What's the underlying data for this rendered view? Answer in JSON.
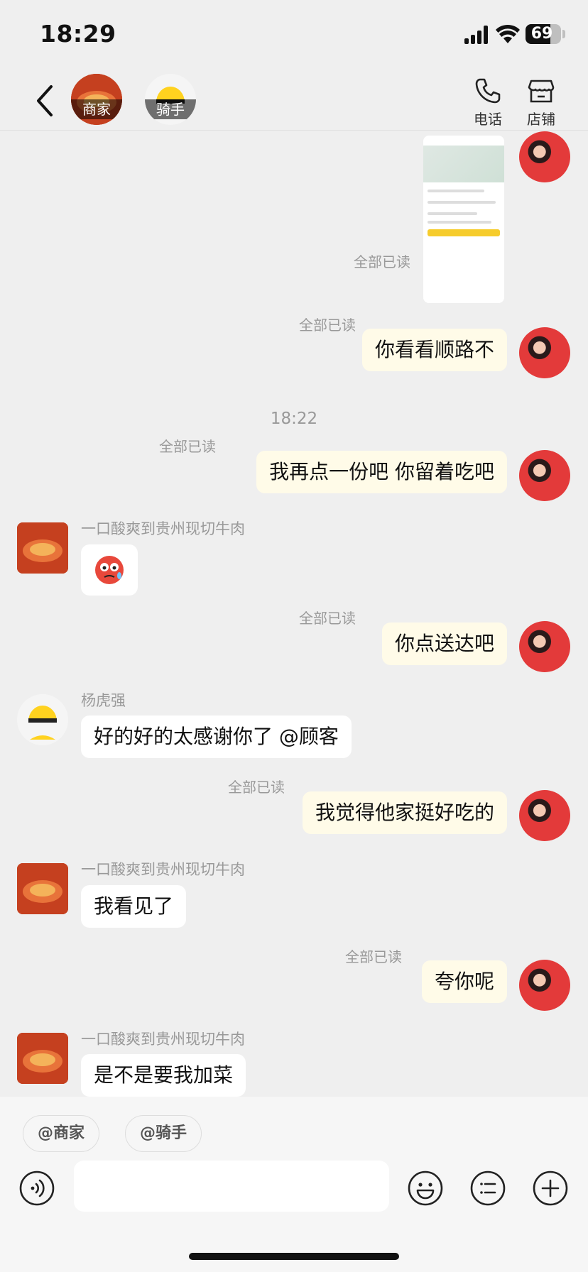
{
  "status_bar": {
    "time": "18:29",
    "battery": "69",
    "battery_level": 0.69
  },
  "header": {
    "merchant_label": "商家",
    "rider_label": "骑手",
    "phone_label": "电话",
    "shop_label": "店铺"
  },
  "messages": {
    "m1_read": "全部已读",
    "m2_text": "你看看顺路不",
    "m2_read": "全部已读",
    "timestamp": "18:22",
    "m3_text": "我再点一份吧 你留着吃吧",
    "m3_read": "全部已读",
    "m4_sender": "一口酸爽到贵州现切牛肉",
    "m5_text": "你点送达吧",
    "m5_read": "全部已读",
    "m6_sender": "杨虎强",
    "m6_text": "好的好的太感谢你了 @顾客",
    "m7_text": "我觉得他家挺好吃的",
    "m7_read": "全部已读",
    "m8_sender": "一口酸爽到贵州现切牛肉",
    "m8_text": "我看见了",
    "m9_text": "夸你呢",
    "m9_read": "全部已读",
    "m10_sender": "一口酸爽到贵州现切牛肉",
    "m10_text": "是不是要我加菜"
  },
  "composer": {
    "mention_merchant": "@商家",
    "mention_rider": "@骑手",
    "input_value": ""
  },
  "colors": {
    "outgoing_bubble": "#fffbe8",
    "incoming_bubble": "#ffffff",
    "background": "#efefef",
    "accent_yellow": "#f6cc2c"
  }
}
